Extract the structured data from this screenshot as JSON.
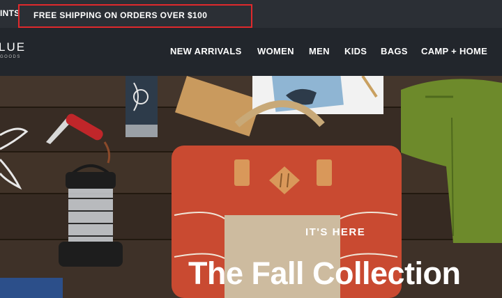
{
  "announcement": {
    "left_text": "INTS",
    "promo": "FREE SHIPPING ON ORDERS OVER $100"
  },
  "header": {
    "logo_main": "LUE",
    "logo_sub": "GOODS",
    "nav": [
      "NEW ARRIVALS",
      "WOMEN",
      "MEN",
      "KIDS",
      "BAGS",
      "CAMP + HOME"
    ]
  },
  "hero": {
    "eyebrow": "IT'S HERE",
    "headline": "The Fall Collection"
  },
  "colors": {
    "promo_outline": "#e0292c",
    "backpack": "#c94a31",
    "wood": "#3b2f27"
  }
}
